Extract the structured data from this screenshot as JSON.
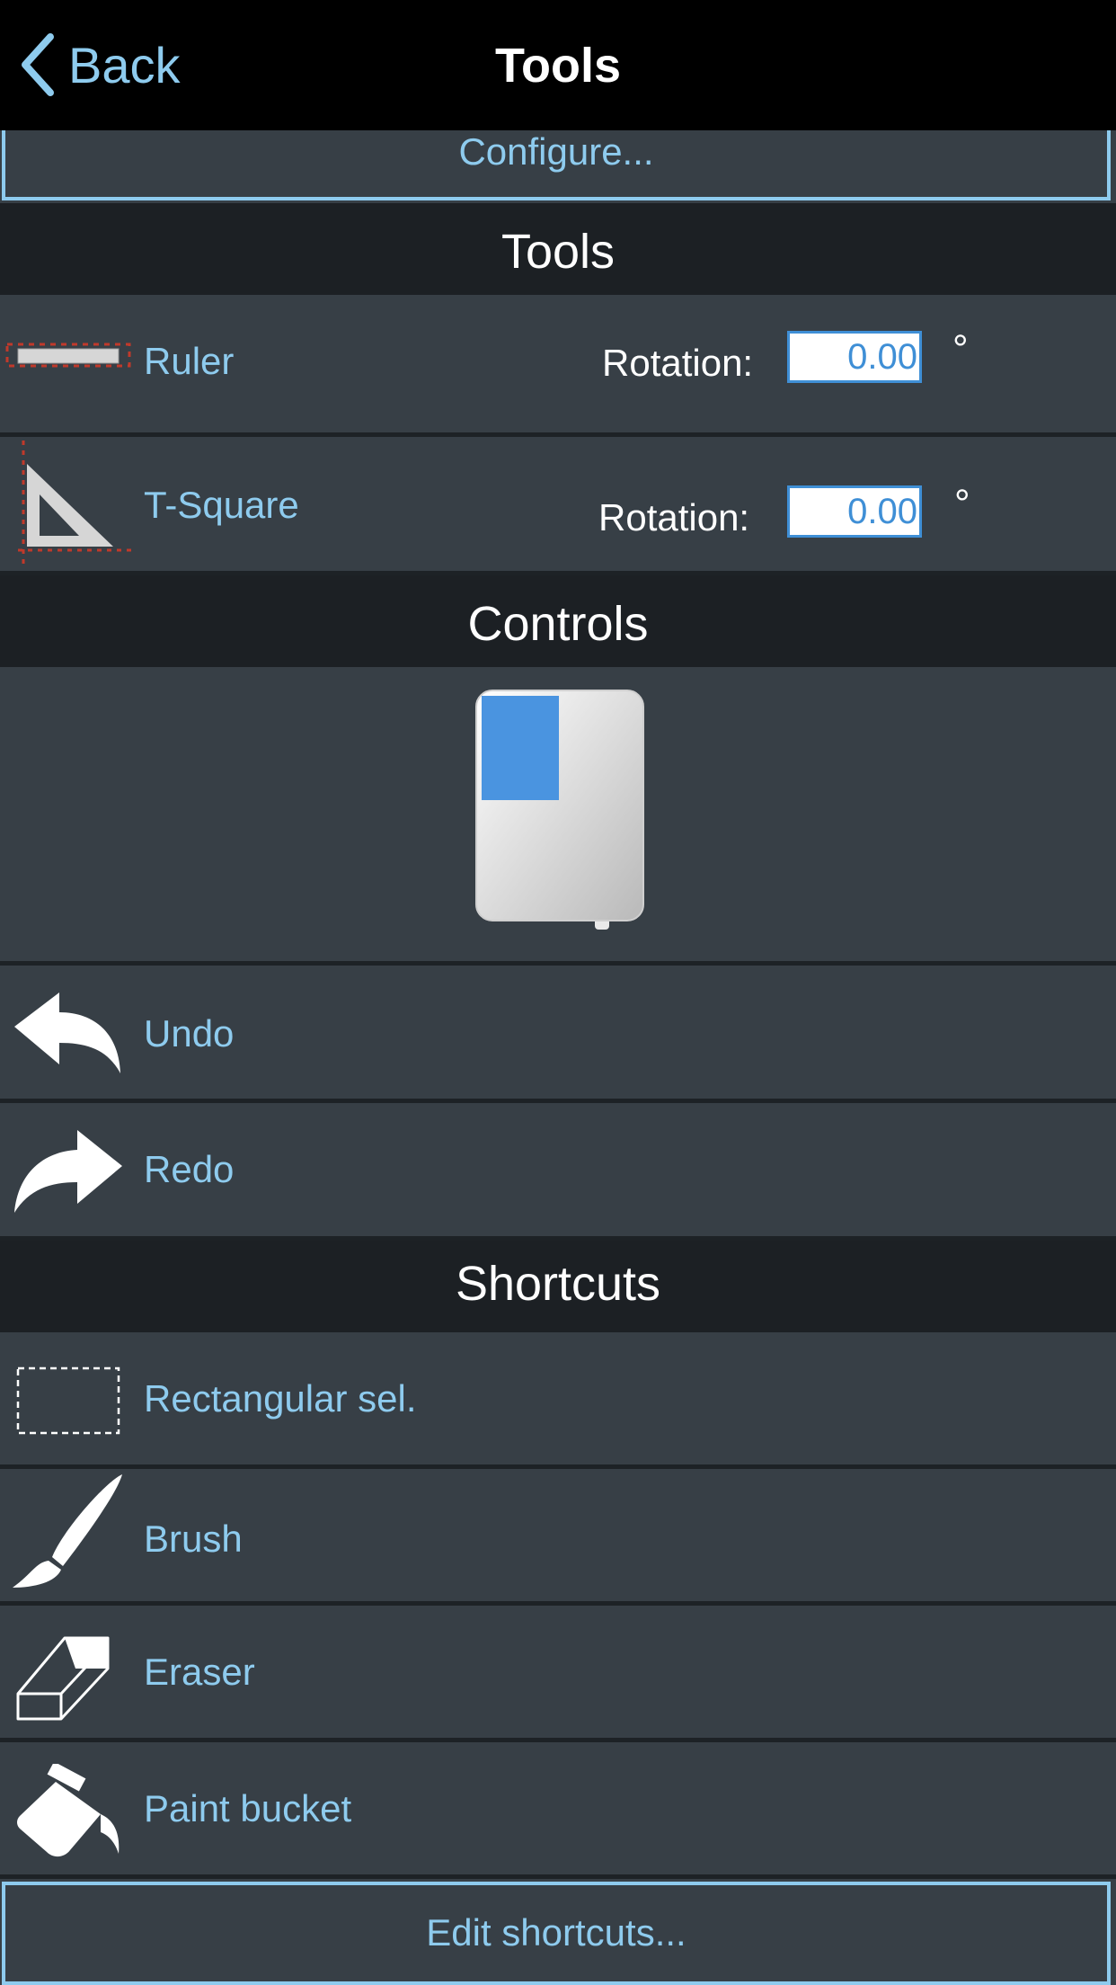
{
  "navbar": {
    "back_label": "Back",
    "title": "Tools"
  },
  "configure_label": "Configure...",
  "sections": {
    "tools": "Tools",
    "controls": "Controls",
    "shortcuts": "Shortcuts"
  },
  "tools": {
    "ruler": {
      "label": "Ruler",
      "rotation_label": "Rotation:",
      "rotation_value": "0.00",
      "unit": "°",
      "icon": "ruler-icon"
    },
    "tsquare": {
      "label": "T-Square",
      "rotation_label": "Rotation:",
      "rotation_value": "0.00",
      "unit": "°",
      "icon": "t-square-icon"
    }
  },
  "controls": {
    "mouse_icon": "mouse-left-button-icon",
    "undo_label": "Undo",
    "redo_label": "Redo"
  },
  "shortcuts": {
    "items": [
      {
        "label": "Rectangular sel.",
        "icon": "rectangular-selection-icon"
      },
      {
        "label": "Brush",
        "icon": "brush-icon"
      },
      {
        "label": "Eraser",
        "icon": "eraser-icon"
      },
      {
        "label": "Paint bucket",
        "icon": "paint-bucket-icon"
      }
    ],
    "edit_label": "Edit shortcuts..."
  },
  "colors": {
    "accent": "#8ecbee",
    "navbar": "#000000",
    "row": "#373f46",
    "header": "#1c2024"
  }
}
